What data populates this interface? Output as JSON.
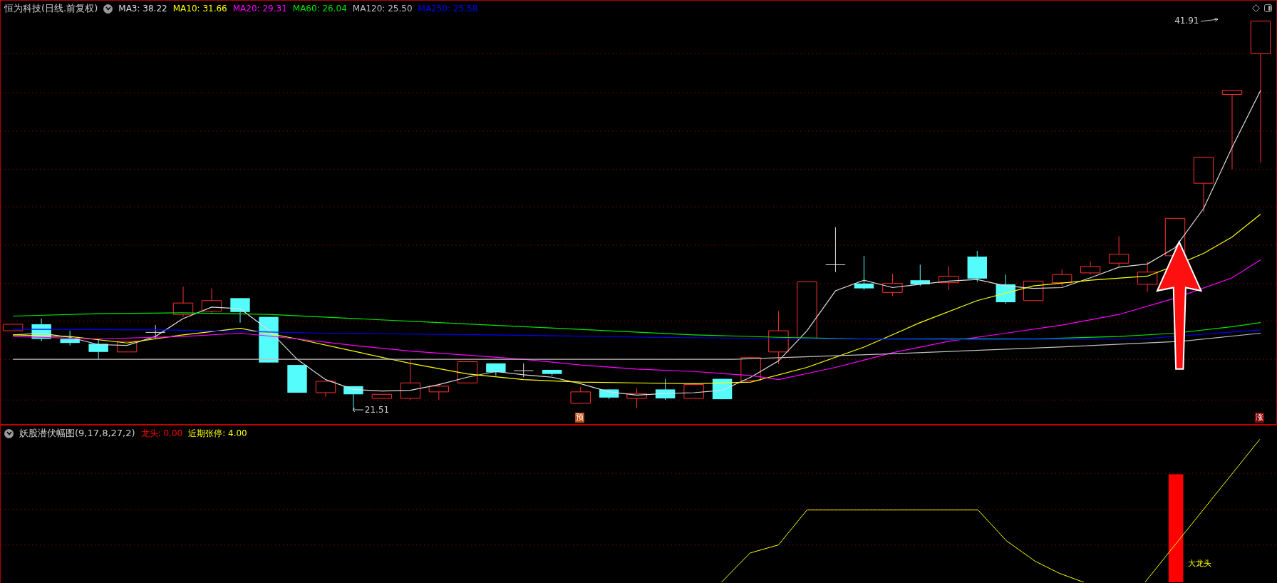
{
  "main_panel": {
    "title": "恒为科技(日线.前复权)",
    "indicators": [
      {
        "label": "MA3: 38.22",
        "color": "#dcdcdc"
      },
      {
        "label": "MA10: 31.66",
        "color": "#ffff00"
      },
      {
        "label": "MA20: 29.31",
        "color": "#ff00ff"
      },
      {
        "label": "MA60: 26.04",
        "color": "#00e600"
      },
      {
        "label": "MA120: 25.50",
        "color": "#c0c0c0"
      },
      {
        "label": "MA250: 25.58",
        "color": "#0000ff"
      }
    ],
    "low_label": "21.51",
    "high_label": "41.91",
    "markers": [
      {
        "text": "预",
        "kind": "forecast"
      },
      {
        "text": "涨",
        "kind": "rise"
      }
    ]
  },
  "indicator_panel": {
    "title": "妖股潜伏幅图(9,17,8,27,2)",
    "values": [
      {
        "label": "龙头: 0.00",
        "color": "#ff0000"
      },
      {
        "label": "近期张停: 4.00",
        "color": "#ffff00"
      }
    ],
    "signal_label": "大龙头"
  }
}
